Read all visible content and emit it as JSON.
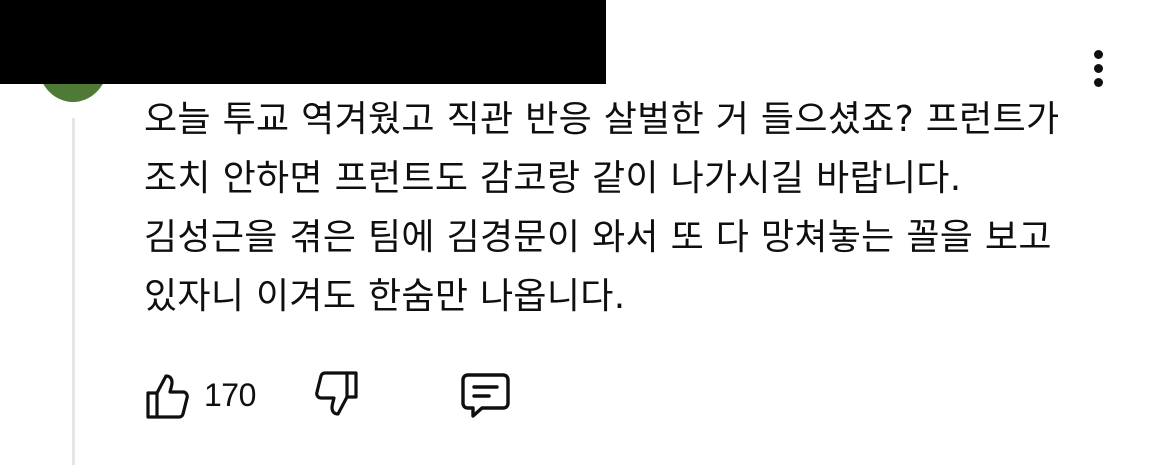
{
  "comment": {
    "text": "오늘 투교 역겨웠고 직관 반응 살벌한 거 들으셨죠? 프런트가 조치 안하면 프런트도 감코랑 같이 나가시길 바랍니다. 김성근을 겪은 팀에 김경문이 와서 또 다 망쳐놓는 꼴을 보고 있자니 이겨도 한숨만 나옵니다.",
    "like_count": "170"
  },
  "icons": {
    "like": "thumbs-up-icon",
    "dislike": "thumbs-down-icon",
    "reply": "comment-icon",
    "menu": "more-vertical-icon"
  },
  "colors": {
    "avatar": "#4f7a35",
    "redaction": "#000000",
    "text": "#0f0f0f",
    "thread_line": "#e5e5e5"
  }
}
